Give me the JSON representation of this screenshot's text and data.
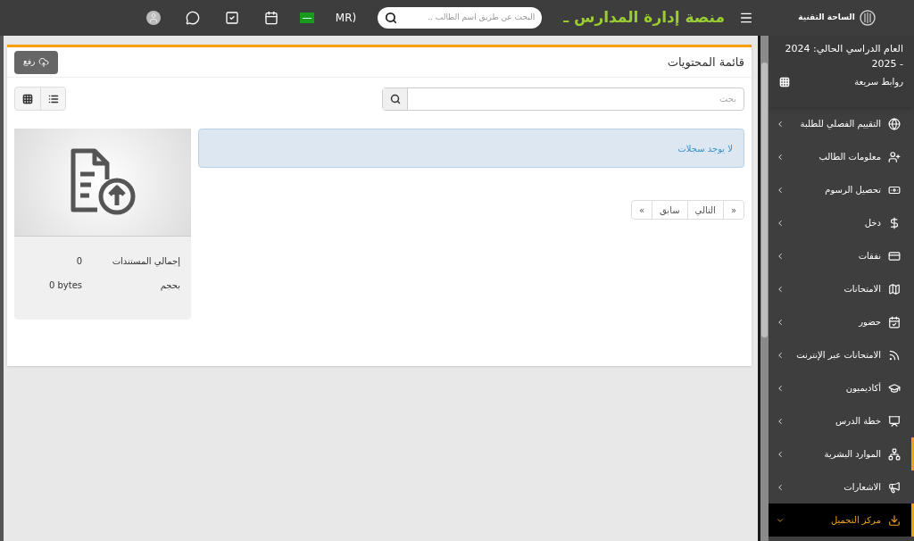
{
  "topbar": {
    "brand": "الساحة التقنية",
    "title": "منصة إدارة المدارس ـ",
    "search": {
      "placeholder": "البحث عن طريق اسم الطالب .."
    },
    "currency": "MR)"
  },
  "sidebar": {
    "academic_year": "العام الدراسي الحالي: 2024 - 2025",
    "quick_links": "روابط سريعة",
    "items": [
      {
        "label": "التقييم الفصلي للطلبة",
        "selected": false,
        "accent": false
      },
      {
        "label": "معلومات الطالب",
        "selected": false,
        "accent": false
      },
      {
        "label": "تحصيل الرسوم",
        "selected": false,
        "accent": false
      },
      {
        "label": "دخل",
        "selected": false,
        "accent": false
      },
      {
        "label": "نفقات",
        "selected": false,
        "accent": false
      },
      {
        "label": "الامتحانات",
        "selected": false,
        "accent": false
      },
      {
        "label": "حضور",
        "selected": false,
        "accent": false
      },
      {
        "label": "الامتحانات عبر الإنترنت",
        "selected": false,
        "accent": false
      },
      {
        "label": "أكاديميون",
        "selected": false,
        "accent": false
      },
      {
        "label": "خطة الدرس",
        "selected": false,
        "accent": false
      },
      {
        "label": "الموارد البشرية",
        "selected": false,
        "accent": true
      },
      {
        "label": "الاشعارات",
        "selected": false,
        "accent": false
      },
      {
        "label": "مركز التحميل",
        "selected": true,
        "accent": true
      }
    ]
  },
  "panel": {
    "title": "قائمة المحتويات",
    "upload_button": "رفع",
    "search": {
      "placeholder": "بحث"
    },
    "empty_message": "لا يوجد سجلات",
    "pagination": [
      "«",
      "التالي",
      "سابق",
      "»"
    ],
    "summary": [
      {
        "label": "إجمالي المستندات",
        "value": "0"
      },
      {
        "label": "بحجم",
        "value": "0 bytes"
      }
    ]
  }
}
